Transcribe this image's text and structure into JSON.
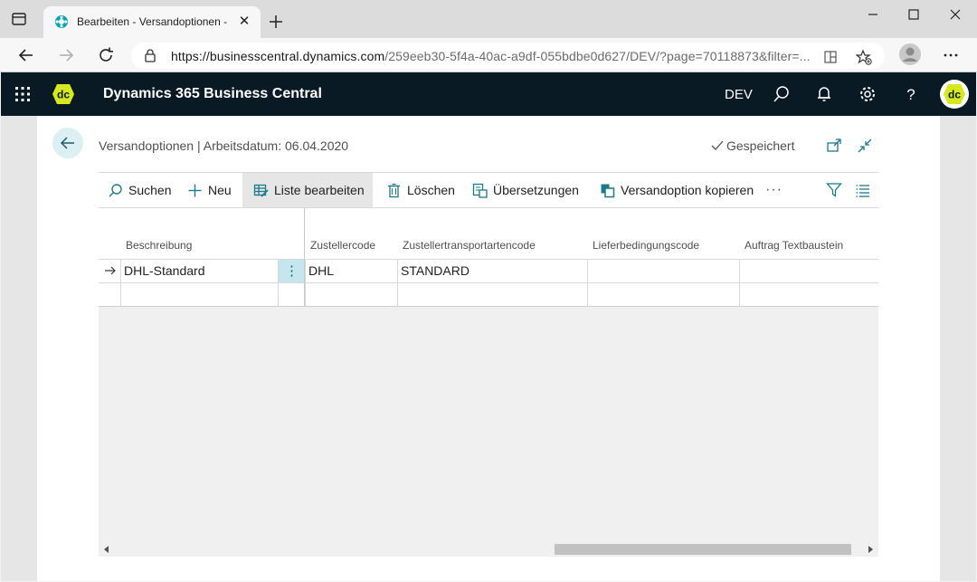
{
  "browser": {
    "tab_title": "Bearbeiten - Versandoptionen - D",
    "url_host": "https://businesscentral.dynamics.com",
    "url_path": "/259eeb30-5f4a-40ac-a9df-055bdbe0d627/DEV/?page=70118873&filter=..."
  },
  "app": {
    "title": "Dynamics 365 Business Central",
    "environment": "DEV",
    "logo_text": "dc"
  },
  "page": {
    "title": "Versandoptionen | Arbeitsdatum: 06.04.2020",
    "saved_label": "Gespeichert"
  },
  "actions": [
    {
      "label": "Suchen",
      "icon": "search-icon"
    },
    {
      "label": "Neu",
      "icon": "plus-icon"
    },
    {
      "label": "Liste bearbeiten",
      "icon": "edit-list-icon"
    },
    {
      "label": "Löschen",
      "icon": "trash-icon"
    },
    {
      "label": "Übersetzungen",
      "icon": "translate-icon"
    },
    {
      "label": "Versandoption kopieren",
      "icon": "copy-icon"
    }
  ],
  "grid": {
    "columns": [
      "Beschreibung",
      "Zustellercode",
      "Zustellertransportartencode",
      "Lieferbedingungscode",
      "Auftrag Textbaustein"
    ],
    "rows": [
      {
        "beschreibung": "DHL-Standard",
        "zustellercode": "DHL",
        "transportart": "STANDARD",
        "lieferbedingung": "",
        "textbaustein": ""
      },
      {
        "beschreibung": "",
        "zustellercode": "",
        "transportart": "",
        "lieferbedingung": "",
        "textbaustein": ""
      }
    ]
  },
  "colors": {
    "nav_bg": "#0a1a24",
    "accent": "#00a4b4",
    "logo_yellow": "#d7e81e",
    "selected_cell": "#c3e7ed"
  }
}
